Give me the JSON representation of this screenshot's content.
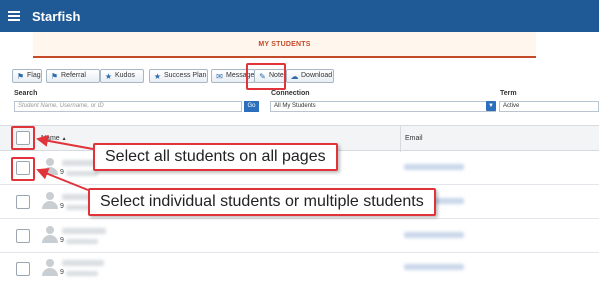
{
  "header": {
    "app_title": "Starfish"
  },
  "tab": {
    "label": "MY STUDENTS"
  },
  "toolbar": {
    "buttons": [
      {
        "label": "Flag",
        "icon": "flag-icon"
      },
      {
        "label": "Referral",
        "icon": "referral-icon"
      },
      {
        "label": "Kudos",
        "icon": "kudos-icon"
      },
      {
        "label": "Success Plan",
        "icon": "success-plan-icon"
      },
      {
        "label": "Message",
        "icon": "envelope-icon"
      },
      {
        "label": "Note",
        "icon": "note-icon"
      },
      {
        "label": "Download",
        "icon": "download-icon"
      }
    ]
  },
  "filters": {
    "search_label": "Search",
    "search_placeholder": "Student Name, Username, or ID",
    "go_label": "Go",
    "connection_label": "Connection",
    "connection_value": "All My Students",
    "term_label": "Term",
    "term_value": "Active"
  },
  "grid": {
    "name_header": "Name",
    "email_header": "Email",
    "rows": [
      {
        "id_prefix": "9"
      },
      {
        "id_prefix": "9"
      },
      {
        "id_prefix": "9"
      },
      {
        "id_prefix": "9"
      }
    ]
  },
  "annotations": {
    "select_all": "Select all students on all pages",
    "select_individual": "Select individual students or multiple students"
  },
  "colors": {
    "header_bg": "#1f5a96",
    "accent": "#c44a2a",
    "highlight": "#e0333a",
    "button_blue": "#2c6fbc"
  }
}
